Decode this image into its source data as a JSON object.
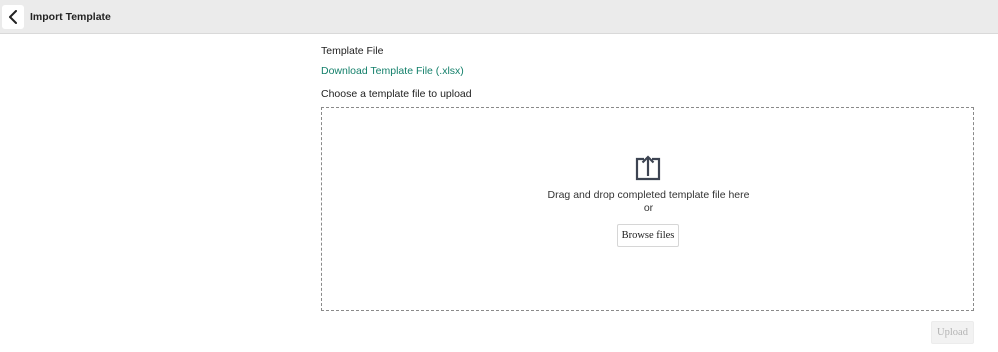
{
  "header": {
    "title": "Import Template",
    "back_icon": "chevron-left-icon"
  },
  "form": {
    "template_file_label": "Template File",
    "download_link": "Download Template File (.xlsx)",
    "choose_label": "Choose a template file to upload"
  },
  "dropzone": {
    "icon": "upload-icon",
    "drag_text": "Drag and drop completed template file here",
    "or_text": "or",
    "browse_label": "Browse files"
  },
  "footer": {
    "upload_label": "Upload"
  },
  "colors": {
    "link": "#14806b",
    "header_bg": "#ebebeb",
    "icon": "#3d4452"
  }
}
